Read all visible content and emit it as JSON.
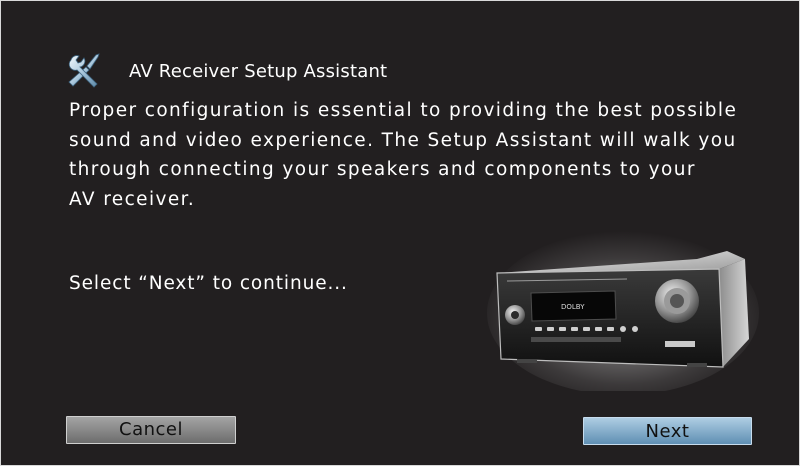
{
  "header": {
    "title": "AV Receiver Setup Assistant",
    "icon": "tools-icon"
  },
  "description": {
    "lines": [
      "Proper configuration is essential to providing the best possible",
      "sound and video experience. The Setup Assistant will walk you",
      "through connecting your speakers and components to your",
      "AV receiver."
    ]
  },
  "prompt": "Select “Next” to continue...",
  "buttons": {
    "cancel_label": "Cancel",
    "next_label": "Next"
  },
  "device": {
    "display_text": "DOLBY",
    "icon": "av-receiver-image"
  },
  "colors": {
    "background": "#221f20",
    "next_button": "#7fa8c8",
    "cancel_button": "#888888"
  }
}
